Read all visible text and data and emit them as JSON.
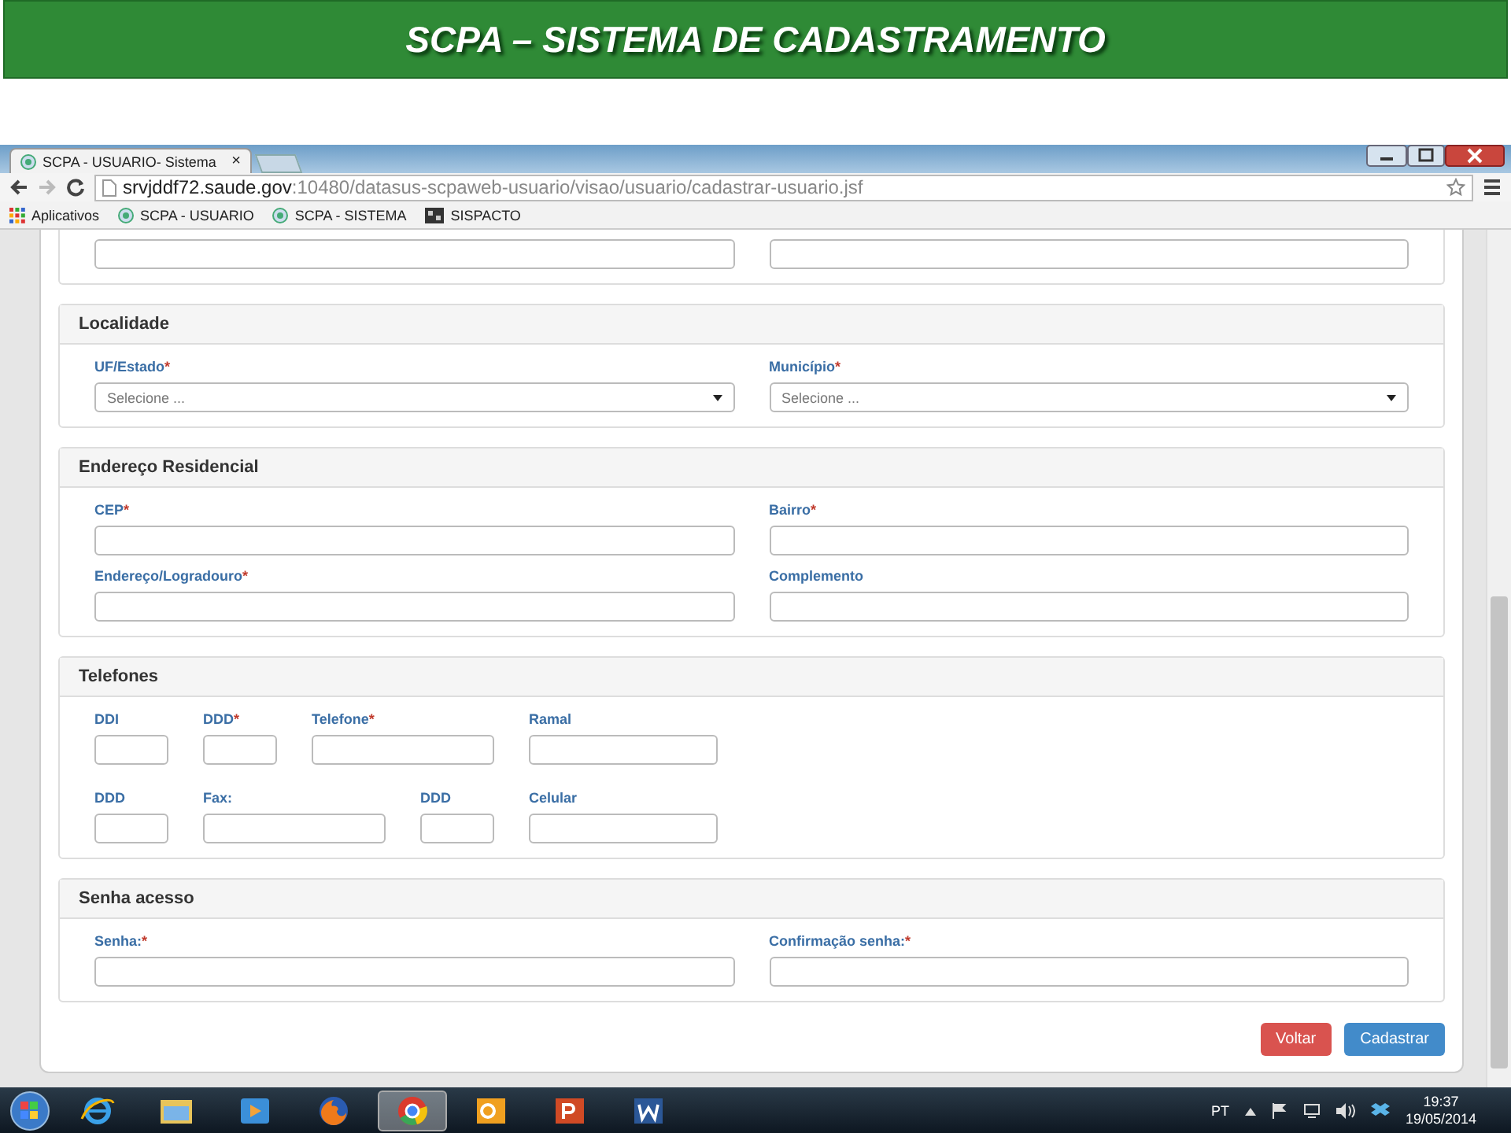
{
  "slide_title": "SCPA – SISTEMA DE CADASTRAMENTO",
  "browser": {
    "tab_title": "SCPA - USUARIO- Sistema",
    "tab_close": "×",
    "url_host": "srvjddf72.saude.gov",
    "url_path": ":10480/datasus-scpaweb-usuario/visao/usuario/cadastrar-usuario.jsf",
    "bookmarks": [
      {
        "kind": "apps",
        "label": "Aplicativos"
      },
      {
        "kind": "site",
        "label": "SCPA - USUARIO"
      },
      {
        "kind": "site",
        "label": "SCPA - SISTEMA"
      },
      {
        "kind": "folder",
        "label": "SISPACTO"
      }
    ]
  },
  "form": {
    "partial_fields": [
      {
        "kind": "text"
      },
      {
        "kind": "text"
      }
    ],
    "sections": [
      {
        "kind": "two-column",
        "title": "Localidade",
        "fields": [
          {
            "kind": "select",
            "label": "UF/Estado",
            "required_mark": "*",
            "placeholder": "Selecione ..."
          },
          {
            "kind": "select",
            "label": "Município",
            "required_mark": "*",
            "placeholder": "Selecione ..."
          }
        ]
      },
      {
        "kind": "two-column",
        "title": "Endereço Residencial",
        "fields": [
          {
            "kind": "text",
            "label": "CEP",
            "required_mark": "*"
          },
          {
            "kind": "text",
            "label": "Bairro",
            "required_mark": "*"
          },
          {
            "kind": "text",
            "label": "Endereço/Logradouro",
            "required_mark": "*"
          },
          {
            "kind": "text",
            "label": "Complemento"
          }
        ]
      },
      {
        "kind": "phones",
        "title": "Telefones",
        "fields": [
          {
            "kind": "text",
            "label": "DDI"
          },
          {
            "kind": "text",
            "label": "DDD",
            "required_mark": "*"
          },
          {
            "kind": "text",
            "label": "Telefone",
            "required_mark": "*"
          },
          {
            "kind": "text",
            "label": "Ramal"
          },
          {
            "kind": "text",
            "label": "DDD"
          },
          {
            "kind": "text",
            "label": "Fax:"
          },
          {
            "kind": "text",
            "label": "DDD"
          },
          {
            "kind": "text",
            "label": "Celular"
          }
        ]
      },
      {
        "kind": "two-column",
        "title": "Senha acesso",
        "fields": [
          {
            "kind": "password",
            "label": "Senha:",
            "required_mark": "*"
          },
          {
            "kind": "password",
            "label": "Confirmação senha:",
            "required_mark": "*"
          }
        ]
      }
    ],
    "buttons": [
      {
        "kind": "danger",
        "label": "Voltar"
      },
      {
        "kind": "primary",
        "label": "Cadastrar"
      }
    ]
  },
  "taskbar": {
    "apps": [
      {
        "kind": "ie",
        "selected": false
      },
      {
        "kind": "folder",
        "selected": false
      },
      {
        "kind": "media",
        "selected": false
      },
      {
        "kind": "firefox",
        "selected": false
      },
      {
        "kind": "chrome",
        "selected": true
      },
      {
        "kind": "outlook",
        "selected": false
      },
      {
        "kind": "powerpoint",
        "selected": false
      },
      {
        "kind": "word",
        "selected": false
      }
    ],
    "language": "PT",
    "time": "19:37",
    "date": "19/05/2014"
  }
}
